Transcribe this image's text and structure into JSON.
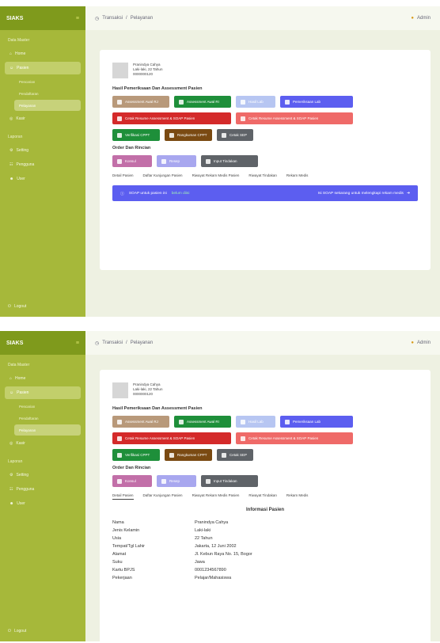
{
  "app": {
    "name": "SIAKS"
  },
  "sidebar": {
    "section_main": "Data Master",
    "item_home": "Home",
    "item_pasien": "Pasien",
    "sub_items": [
      "Pencarian",
      "Pendaftaran",
      "Pelayanan"
    ],
    "item_kasir": "Kasir",
    "section_reports": "Laporan",
    "item_setting": "Setting",
    "item_pengguna": "Pengguna",
    "item_user": "User",
    "logout": "Logout"
  },
  "breadcrumb": {
    "parent": "Transaksi",
    "separator": "/",
    "current": "Pelayanan"
  },
  "user": {
    "name": "Admin"
  },
  "patient": {
    "name": "Pranindya Cahya",
    "line2": "Laki-laki, 22 Tahun",
    "line3": "0000000120"
  },
  "actions": {
    "section_title": "Hasil Pemeriksaan Dan Assessment Pasien",
    "row1": [
      "Assessment Awal RJ",
      "Assessment Awal RI",
      "Hasil Lab",
      "Pemeriksaan Lab"
    ],
    "row2": [
      "Cetak Resume Assessment & SOAP Pasien",
      "Cetak Resume Assessment & SOAP Pasien"
    ],
    "row3": [
      "Verifikasi CPPT",
      "Rangkuman CPPT",
      "Cetak SEP"
    ],
    "section2_title": "Order Dan Rincian",
    "row4": [
      "Konsul",
      "Resep",
      "Input Tindakan"
    ]
  },
  "tabs": [
    "Detail Pasien",
    "Daftar Kunjungan Pasien",
    "Riwayat Rekam Medis Pasien",
    "Riwayat Tindakan",
    "Rekam Medis"
  ],
  "info_bar": {
    "left": "SOAP untuk pasien ini",
    "left_highlight": "belum diisi",
    "right": "Isi SOAP sekarang untuk melengkapi rekam medis"
  },
  "patient_info": {
    "title": "Informasi Pasien",
    "rows": [
      {
        "label": "Nama",
        "value": "Pranindya Cahya"
      },
      {
        "label": "Jenis Kelamin",
        "value": "Laki-laki"
      },
      {
        "label": "Usia",
        "value": "22 Tahun"
      },
      {
        "label": "Tempat/Tgl Lahir",
        "value": "Jakarta, 12 Juni 2002"
      },
      {
        "label": "Alamat",
        "value": "Jl. Kebun Raya No. 15, Bogor"
      },
      {
        "label": "Suku",
        "value": "Jawa"
      },
      {
        "label": "Kartu BPJS",
        "value": "0001234567890"
      },
      {
        "label": "Pekerjaan",
        "value": "Pelajar/Mahasiswa"
      }
    ]
  },
  "colors": {
    "sidebar": "#a6b83a",
    "brand_bar": "#7f9a1c",
    "tan": "#b8997a",
    "green": "#1e8f3a",
    "light_blue": "#b7c6f2",
    "indigo": "#5c5ef0",
    "red": "#d42a2a",
    "salmon": "#ef6a68",
    "brown": "#7a4a12",
    "grey": "#5f6368",
    "mauve": "#c26fa8",
    "periwinkle": "#a8a7ef"
  }
}
